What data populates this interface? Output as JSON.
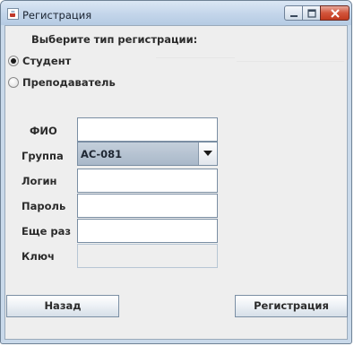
{
  "window": {
    "title": "Регистрация",
    "controls": {
      "minimize": "minimize",
      "maximize": "maximize",
      "close": "close"
    }
  },
  "form": {
    "prompt": "Выберите тип регистрации:",
    "radios": [
      {
        "label": "Студент",
        "selected": true
      },
      {
        "label": "Преподаватель",
        "selected": false
      }
    ],
    "fields": {
      "fio": {
        "label": "ФИО",
        "value": ""
      },
      "group": {
        "label": "Группа",
        "value": "АС-081"
      },
      "login": {
        "label": "Логин",
        "value": ""
      },
      "password": {
        "label": "Пароль",
        "value": ""
      },
      "repeat": {
        "label": "Еще раз",
        "value": ""
      },
      "key": {
        "label": "Ключ",
        "value": ""
      }
    }
  },
  "buttons": {
    "back": "Назад",
    "register": "Регистрация"
  },
  "colors": {
    "title_bar": "#c9d9ea",
    "client": "#eeeeee",
    "close_button": "#d2553b",
    "combo_selected": "#aebdcd"
  },
  "icons": {
    "app": "java-cup-icon",
    "minimize": "minimize-icon",
    "maximize": "maximize-icon",
    "close": "close-icon",
    "dropdown": "chevron-down-icon"
  }
}
